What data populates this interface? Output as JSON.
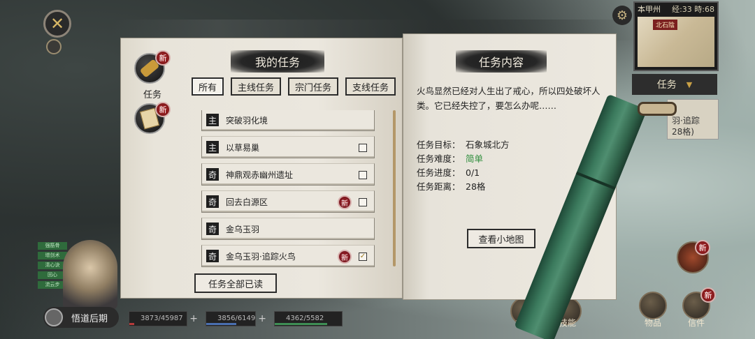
{
  "hud": {
    "close_icon": "close-icon",
    "minimap": {
      "location": "本甲州",
      "time": "经:33 時:68",
      "place_tag": "北石陰"
    },
    "task_tab": {
      "label": "任务",
      "peek_lines": [
        "羽·追踪",
        "28格)"
      ]
    },
    "icons": [
      {
        "name": "explore",
        "label": "探索"
      },
      {
        "name": "skills",
        "label": "技能"
      },
      {
        "name": "items",
        "label": "物品"
      },
      {
        "name": "letters",
        "label": "信件",
        "badge": "新"
      }
    ],
    "hero": {
      "realm": "悟道后期",
      "statuses": [
        "强筋骨",
        "增剑术",
        "清心诀",
        "回心",
        "流云步"
      ],
      "hp": "3873/45987",
      "mp": "3856/6149",
      "stamina": "4362/5582"
    }
  },
  "side_tabs": [
    {
      "label": "任务",
      "badge": "新"
    },
    {
      "label": "",
      "badge": "新"
    }
  ],
  "left_page": {
    "title": "我的任务",
    "filters": [
      "所有",
      "主线任务",
      "宗门任务",
      "支线任务"
    ],
    "quests": [
      {
        "type": "主",
        "name": "突破羽化境",
        "is_new": false,
        "checked": false,
        "show_box": false
      },
      {
        "type": "主",
        "name": "以草易巢",
        "is_new": false,
        "checked": false,
        "show_box": true
      },
      {
        "type": "奇",
        "name": "神鼎观赤幽州遗址",
        "is_new": false,
        "checked": false,
        "show_box": true
      },
      {
        "type": "奇",
        "name": "回去白源区",
        "is_new": true,
        "checked": false,
        "show_box": true
      },
      {
        "type": "奇",
        "name": "金乌玉羽",
        "is_new": false,
        "checked": false,
        "show_box": false
      },
      {
        "type": "奇",
        "name": "金乌玉羽·追踪火鸟",
        "is_new": true,
        "checked": true,
        "show_box": true
      }
    ],
    "new_badge": "新",
    "mark_all_read": "任务全部已读"
  },
  "right_page": {
    "title": "任务内容",
    "description": "火鸟显然已经对人生出了戒心，所以四处破坏人类。它已经失控了，要怎么办呢……",
    "fields": [
      {
        "key": "任务目标：",
        "value": "石象城北方"
      },
      {
        "key": "任务难度：",
        "value": "简单",
        "accent": "#2f8e3d"
      },
      {
        "key": "任务进度：",
        "value": "0/1"
      },
      {
        "key": "任务距离：",
        "value": "28格"
      }
    ],
    "view_map_button": "查看小地图"
  }
}
